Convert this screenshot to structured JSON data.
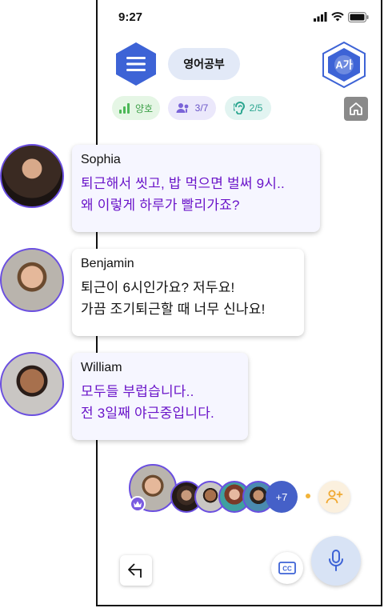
{
  "status_bar": {
    "time": "9:27"
  },
  "header": {
    "menu_icon": "hamburger-icon",
    "room_name": "영어공부",
    "translate_icon": "translate-icon",
    "translate_label": "A가"
  },
  "chips": {
    "signal": {
      "icon": "signal-bars-icon",
      "label": "양호"
    },
    "speakers": {
      "icon": "people-mic-icon",
      "label": "3/7"
    },
    "listeners": {
      "icon": "ear-icon",
      "label": "2/5"
    },
    "home_icon": "home-icon"
  },
  "messages": [
    {
      "sender": "Sophia",
      "lines": [
        "퇴근해서 씻고, 밥 먹으면 벌써 9시..",
        "왜 이렇게 하루가 빨리가죠?"
      ]
    },
    {
      "sender": "Benjamin",
      "lines": [
        "퇴근이 6시인가요? 저두요!",
        "가끔 조기퇴근할 때 너무 신나요!"
      ]
    },
    {
      "sender": "William",
      "lines": [
        "모두들 부럽습니다..",
        "전 3일째 야근중입니다."
      ]
    }
  ],
  "participants": {
    "more_count": "+7",
    "host_badge_icon": "crown-icon",
    "add_icon": "add-user-icon"
  },
  "controls": {
    "exit_icon": "exit-icon",
    "captions_icon": "closed-captions-icon",
    "captions_label": "CC",
    "mic_icon": "microphone-icon"
  },
  "colors": {
    "accent_blue": "#3d63d6",
    "message_violet": "#6a14c9",
    "avatar_ring": "#6a4ee0",
    "more_badge": "#4560c8"
  }
}
